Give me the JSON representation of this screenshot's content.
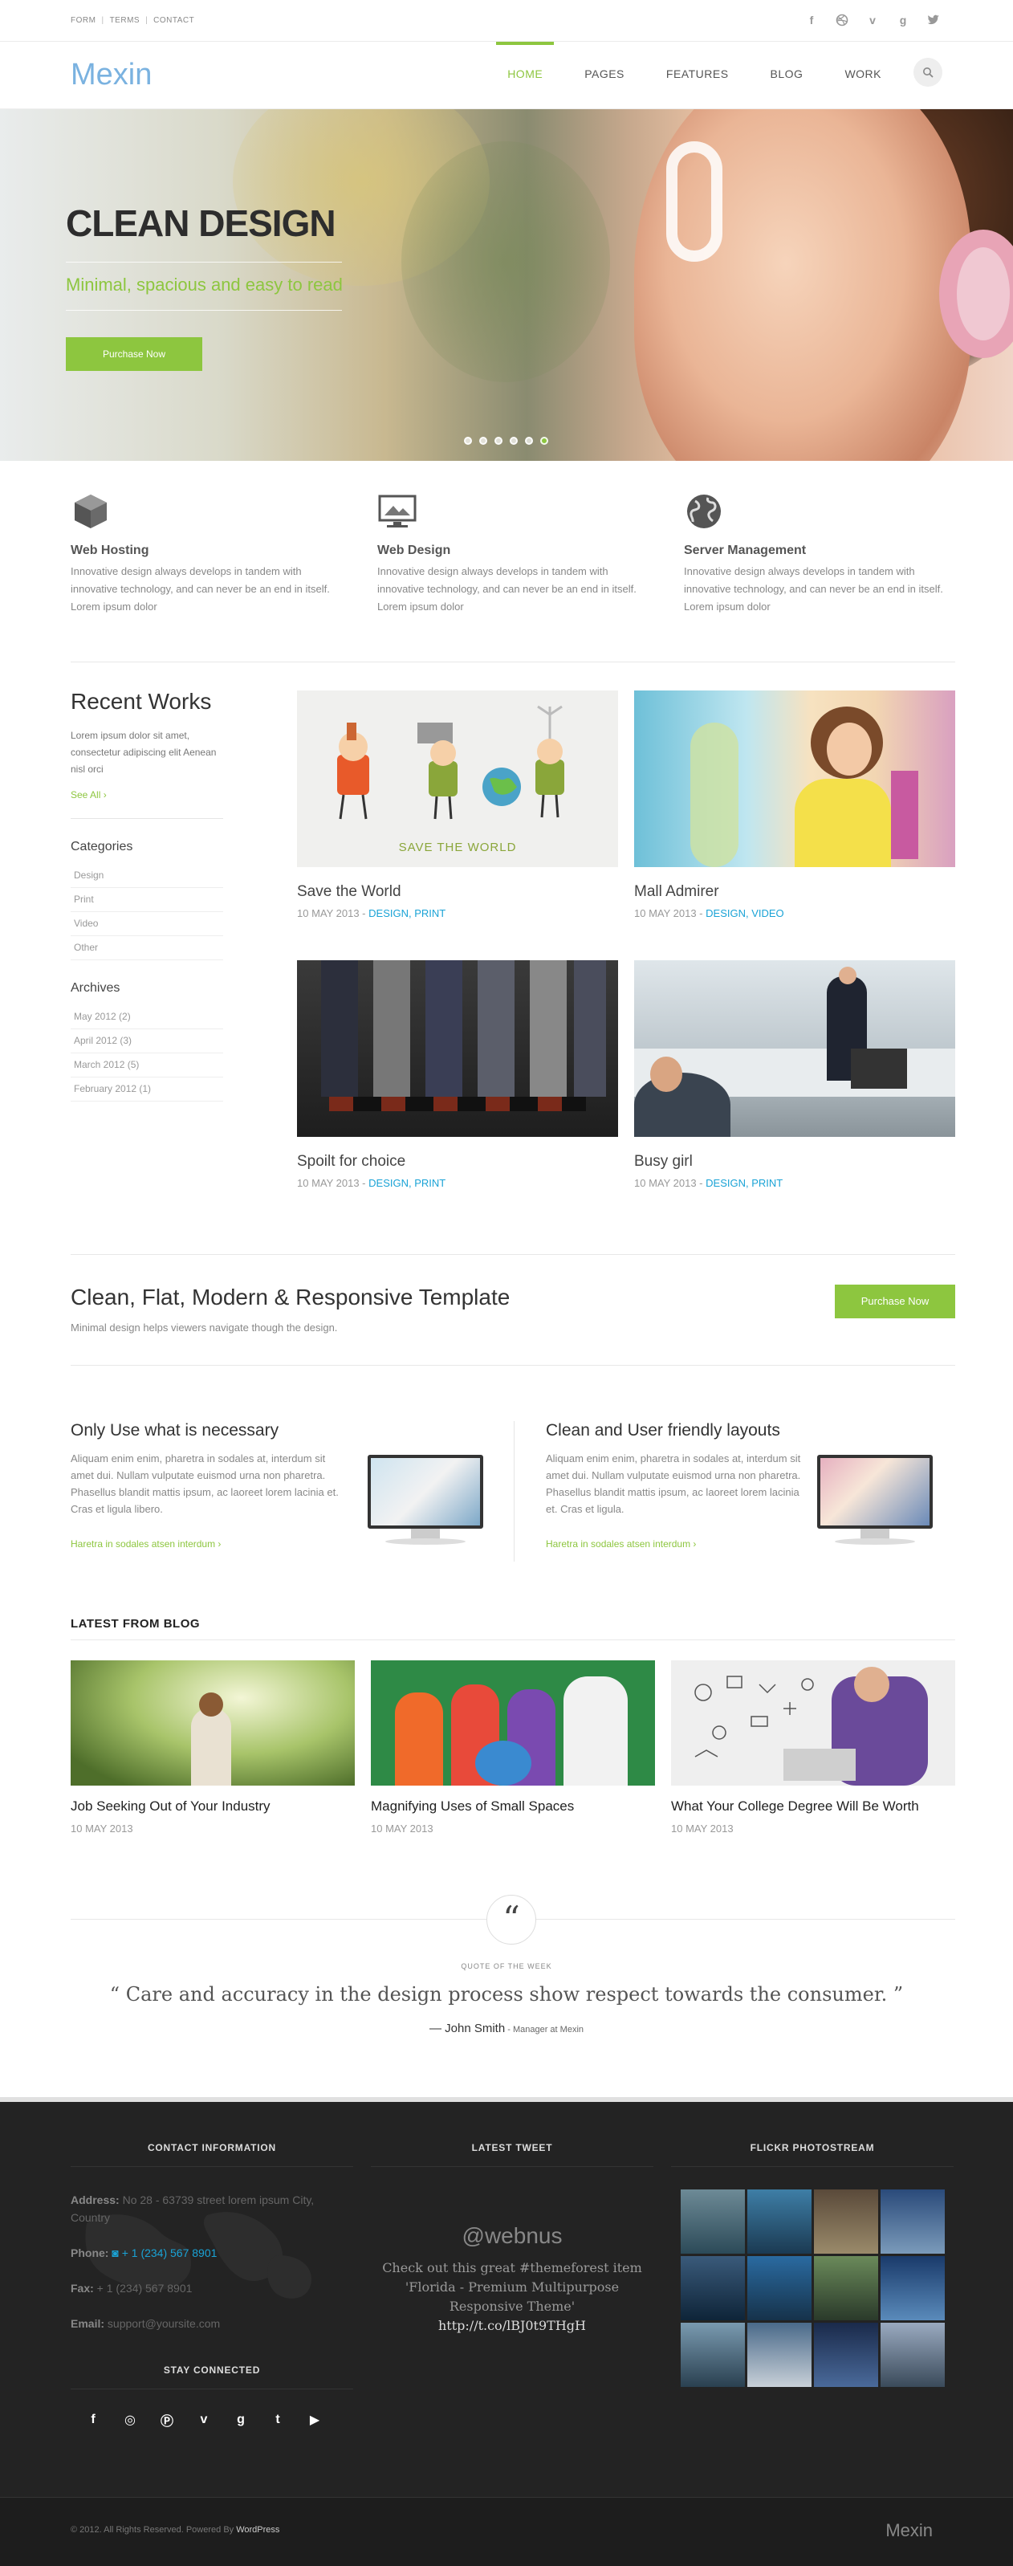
{
  "topbar": {
    "links": [
      "FORM",
      "TERMS",
      "CONTACT"
    ],
    "social_icons": [
      "facebook-icon",
      "dribbble-icon",
      "vimeo-icon",
      "google-plus-icon",
      "twitter-icon"
    ]
  },
  "header": {
    "logo": "Mexin",
    "nav": [
      "HOME",
      "PAGES",
      "FEATURES",
      "BLOG",
      "WORK"
    ],
    "active_nav": "HOME"
  },
  "hero": {
    "title": "CLEAN DESIGN",
    "subtitle": "Minimal, spacious and easy to read",
    "button": "Purchase Now",
    "slides": 6,
    "active_slide": 6
  },
  "services": [
    {
      "icon": "cube-icon",
      "title": "Web Hosting",
      "text": "Innovative design always develops in tandem with innovative technology, and can never be an end in itself. Lorem ipsum dolor"
    },
    {
      "icon": "monitor-icon",
      "title": "Web Design",
      "text": "Innovative design always develops in tandem with innovative technology, and can never be an end in itself. Lorem ipsum dolor"
    },
    {
      "icon": "globe-icon",
      "title": "Server Management",
      "text": "Innovative design always develops in tandem with innovative technology, and can never be an end in itself. Lorem ipsum dolor"
    }
  ],
  "recent_works": {
    "title": "Recent Works",
    "intro": "Lorem ipsum dolor sit amet, consectetur adipiscing elit Aenean nisl orci",
    "see_all": "See All",
    "categories_title": "Categories",
    "categories": [
      "Design",
      "Print",
      "Video",
      "Other"
    ],
    "archives_title": "Archives",
    "archives": [
      "May 2012 (2)",
      "April 2012 (3)",
      "March 2012 (5)",
      "February 2012 (1)"
    ],
    "items": [
      {
        "title": "Save the World",
        "date": "10 MAY 2013 - ",
        "tags": "DESIGN, PRINT",
        "image_text": "SAVE THE WORLD"
      },
      {
        "title": "Mall Admirer",
        "date": "10 MAY 2013 - ",
        "tags": "DESIGN, VIDEO"
      },
      {
        "title": "Spoilt for choice",
        "date": "10 MAY 2013 - ",
        "tags": "DESIGN, PRINT"
      },
      {
        "title": "Busy girl",
        "date": "10 MAY 2013 - ",
        "tags": "DESIGN, PRINT"
      }
    ]
  },
  "cta": {
    "title": "Clean, Flat, Modern & Responsive Template",
    "text": "Minimal design helps viewers navigate though the design.",
    "button": "Purchase Now"
  },
  "features": [
    {
      "title": "Only Use what is necessary",
      "text": "Aliquam enim enim, pharetra in sodales at, interdum sit amet dui. Nullam vulputate euismod urna non pharetra. Phasellus blandit mattis ipsum, ac laoreet lorem lacinia et. Cras et ligula libero.",
      "link": "Haretra in sodales atsen interdum"
    },
    {
      "title": "Clean and User friendly layouts",
      "text": "Aliquam enim enim, pharetra in sodales at, interdum sit amet dui. Nullam vulputate euismod urna non pharetra. Phasellus blandit mattis ipsum, ac laoreet lorem lacinia et. Cras et ligula.",
      "link": "Haretra in sodales atsen interdum"
    }
  ],
  "blog": {
    "title": "LATEST FROM BLOG",
    "posts": [
      {
        "title": "Job Seeking Out of Your Industry",
        "date": "10 MAY 2013"
      },
      {
        "title": "Magnifying Uses of Small Spaces",
        "date": "10 MAY 2013"
      },
      {
        "title": "What Your College Degree Will Be Worth",
        "date": "10 MAY 2013"
      }
    ]
  },
  "quote": {
    "label": "QUOTE OF THE WEEK",
    "open": "“",
    "text": "Care and accuracy in the design process show respect towards the consumer.",
    "close": "”",
    "author": "— John Smith",
    "role": " - Manager at Mexin"
  },
  "footer": {
    "contact_title": "CONTACT INFORMATION",
    "address_label": "Address:",
    "address": " No 28 - 63739 street lorem ipsum City, Country",
    "phone_label": "Phone:",
    "phone": " + 1 (234) 567 8901",
    "fax_label": "Fax:",
    "fax": " + 1 (234) 567 8901",
    "email_label": "Email:",
    "email": " support@yoursite.com",
    "stay_title": "STAY CONNECTED",
    "stay_icons": [
      "facebook-icon",
      "dribbble-icon",
      "pinterest-icon",
      "vimeo-icon",
      "google-plus-icon",
      "twitter-icon",
      "youtube-icon"
    ],
    "tweet_title": "LATEST TWEET",
    "tweet_handle": "@webnus",
    "tweet_text": "Check out this great #themeforest item 'Florida - Premium Multipurpose Responsive Theme'",
    "tweet_url": "http://t.co/lBJ0t9THgH",
    "flickr_title": "FLICKR PHOTOSTREAM",
    "copyright": "© 2012. All Rights Reserved. Powered By ",
    "powered": "WordPress",
    "logo": "Mexin"
  },
  "colors": {
    "accent": "#8dc63f",
    "link_blue": "#1aa3d6",
    "footer_bg": "#232323"
  }
}
